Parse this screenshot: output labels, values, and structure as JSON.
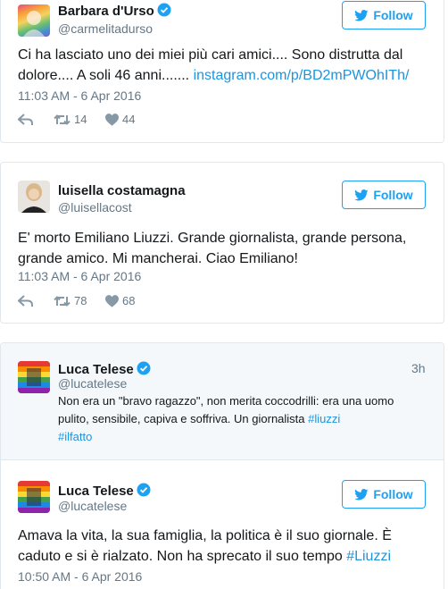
{
  "follow_label": "Follow",
  "colors": {
    "accent": "#1da1f2",
    "link": "#1b95e0",
    "muted": "#657786",
    "text": "#14171a"
  },
  "tweet1": {
    "author": "Barbara d'Urso",
    "handle": "@carmelitadurso",
    "text": "Ci ha lasciato uno dei miei più cari amici.... Sono distrutta dal dolore.... A soli 46 anni....... ",
    "link": "instagram.com/p/BD2mPWOhITh/",
    "timestamp": "11:03 AM - 6 Apr 2016",
    "retweets": "14",
    "likes": "44",
    "icons": [
      "reply-icon",
      "retweet-icon",
      "heart-icon",
      "verified-icon",
      "twitter-bird-icon"
    ]
  },
  "tweet2": {
    "author": "luisella costamagna",
    "handle": "@luisellacost",
    "text": "E' morto Emiliano Liuzzi. Grande giornalista, grande persona, grande amico. Mi mancherai. Ciao Emiliano!",
    "timestamp": "11:03 AM - 6 Apr 2016",
    "retweets": "78",
    "likes": "68"
  },
  "tweet3": {
    "quoted": {
      "author": "Luca Telese",
      "handle": "@lucatelese",
      "ago": "3h",
      "text": "Non era un \"bravo ragazzo\", non merita coccodrilli: era una uomo pulito, sensibile, capiva e soffriva. Un giornalista ",
      "tag1": "#liuzzi",
      "tag2": "#ilfatto"
    },
    "author": "Luca Telese",
    "handle": "@lucatelese",
    "text": "Amava la vita, la sua famiglia, la politica è il suo giornale. È caduto e si è rialzato. Non ha sprecato il suo tempo ",
    "tag": "#Liuzzi",
    "timestamp": "10:50 AM - 6 Apr 2016"
  }
}
